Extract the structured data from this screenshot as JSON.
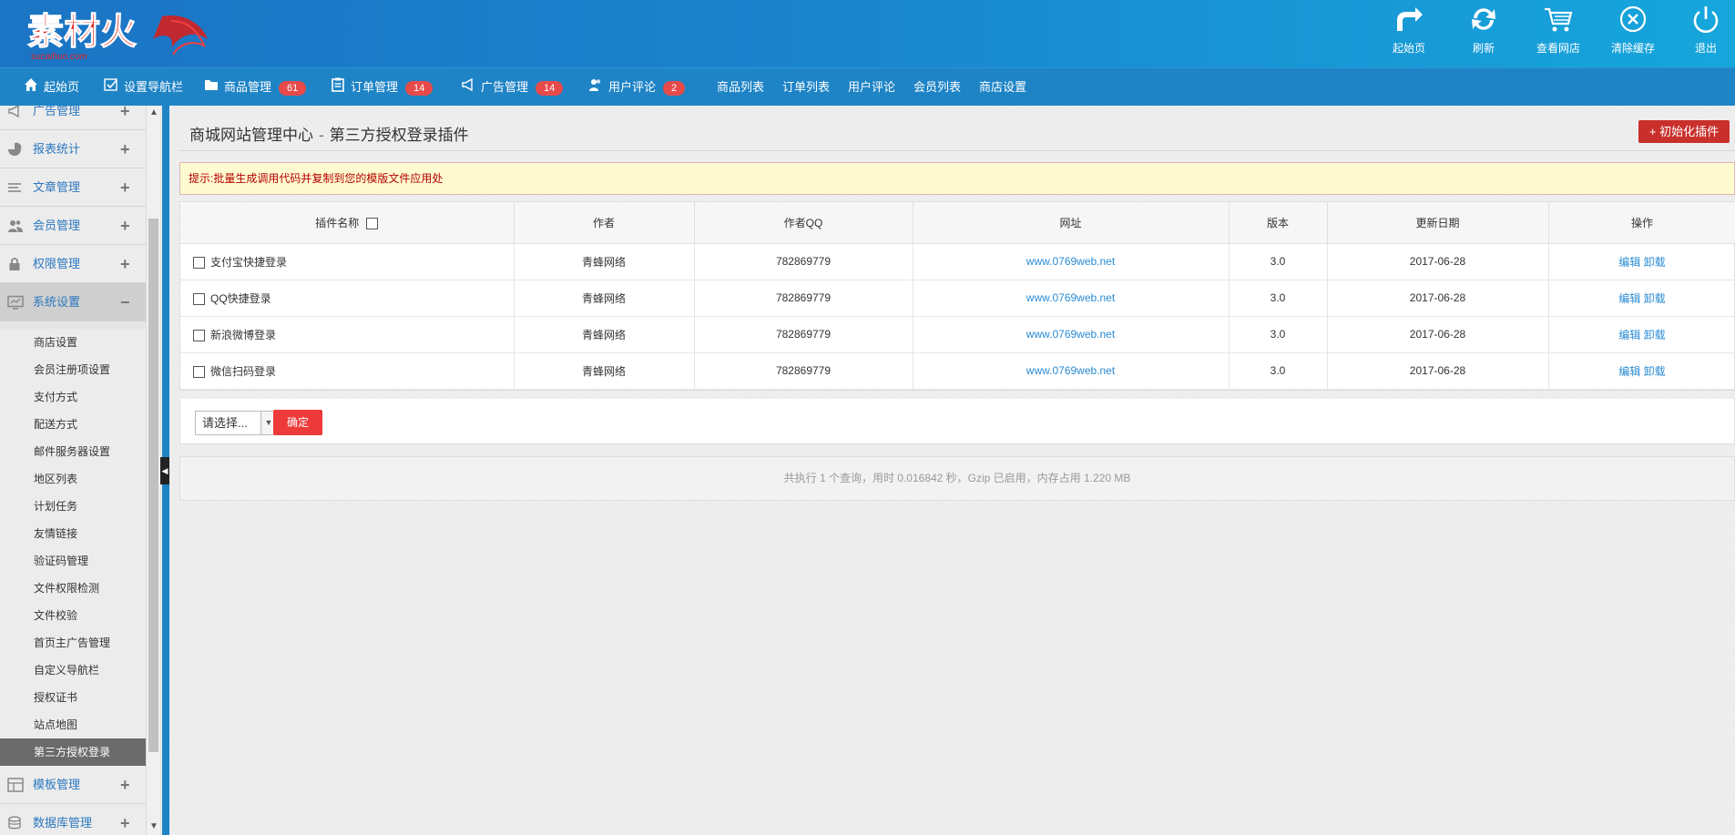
{
  "header": {
    "logo_text": "素材火",
    "logo_sub": "sucaihuo.com",
    "buttons": [
      {
        "label": "起始页",
        "icon": "forward-arrow-icon"
      },
      {
        "label": "刷新",
        "icon": "refresh-icon"
      },
      {
        "label": "查看网店",
        "icon": "cart-icon"
      },
      {
        "label": "清除缓存",
        "icon": "close-circle-icon"
      },
      {
        "label": "退出",
        "icon": "power-icon"
      }
    ]
  },
  "nav": {
    "items": [
      {
        "label": "起始页",
        "icon": "home-icon"
      },
      {
        "label": "设置导航栏",
        "icon": "checklist-icon"
      },
      {
        "label": "商品管理",
        "icon": "folder-icon",
        "badge": "61"
      },
      {
        "label": "订单管理",
        "icon": "clipboard-icon",
        "badge": "14"
      },
      {
        "label": "广告管理",
        "icon": "megaphone-icon",
        "badge": "14"
      },
      {
        "label": "用户评论",
        "icon": "users-icon",
        "badge": "2"
      },
      {
        "label": "商品列表"
      },
      {
        "label": "订单列表"
      },
      {
        "label": "用户评论"
      },
      {
        "label": "会员列表"
      },
      {
        "label": "商店设置"
      }
    ]
  },
  "sidebar": {
    "groups": [
      {
        "label": "广告管理",
        "toggle": "+"
      },
      {
        "label": "报表统计",
        "toggle": "+"
      },
      {
        "label": "文章管理",
        "toggle": "+"
      },
      {
        "label": "会员管理",
        "toggle": "+"
      },
      {
        "label": "权限管理",
        "toggle": "+"
      },
      {
        "label": "系统设置",
        "toggle": "−"
      },
      {
        "label": "模板管理",
        "toggle": "+"
      },
      {
        "label": "数据库管理",
        "toggle": "+"
      }
    ],
    "sub_items": [
      "商店设置",
      "会员注册项设置",
      "支付方式",
      "配送方式",
      "邮件服务器设置",
      "地区列表",
      "计划任务",
      "友情链接",
      "验证码管理",
      "文件权限检测",
      "文件校验",
      "首页主广告管理",
      "自定义导航栏",
      "授权证书",
      "站点地图",
      "第三方授权登录"
    ],
    "active_sub": "第三方授权登录"
  },
  "main": {
    "title": "商城网站管理中心",
    "title_sep": "-",
    "subtitle": "第三方授权登录插件",
    "init_button": "+ 初始化插件",
    "tip": "提示:批量生成调用代码并复制到您的模版文件应用处",
    "table": {
      "headers": [
        "插件名称",
        "作者",
        "作者QQ",
        "网址",
        "版本",
        "更新日期",
        "操作"
      ],
      "rows": [
        {
          "name": "支付宝快捷登录",
          "author": "青蜂网络",
          "qq": "782869779",
          "url": "www.0769web.net",
          "version": "3.0",
          "date": "2017-06-28",
          "edit": "编辑",
          "uninstall": "卸载"
        },
        {
          "name": "QQ快捷登录",
          "author": "青蜂网络",
          "qq": "782869779",
          "url": "www.0769web.net",
          "version": "3.0",
          "date": "2017-06-28",
          "edit": "编辑",
          "uninstall": "卸载"
        },
        {
          "name": "新浪微博登录",
          "author": "青蜂网络",
          "qq": "782869779",
          "url": "www.0769web.net",
          "version": "3.0",
          "date": "2017-06-28",
          "edit": "编辑",
          "uninstall": "卸载"
        },
        {
          "name": "微信扫码登录",
          "author": "青蜂网络",
          "qq": "782869779",
          "url": "www.0769web.net",
          "version": "3.0",
          "date": "2017-06-28",
          "edit": "编辑",
          "uninstall": "卸载"
        }
      ]
    },
    "select_value": "请选择...",
    "confirm_button": "确定",
    "footer": "共执行 1 个查询，用时 0.016842 秒，Gzip 已启用，内存占用 1.220 MB"
  },
  "colors": {
    "header_blue": "#1b74c4",
    "nav_blue": "#1f84c6",
    "badge_red": "#e84a4a",
    "init_btn_red": "#c9302c",
    "link_blue": "#2a8bd4",
    "tip_text": "#b40000"
  }
}
